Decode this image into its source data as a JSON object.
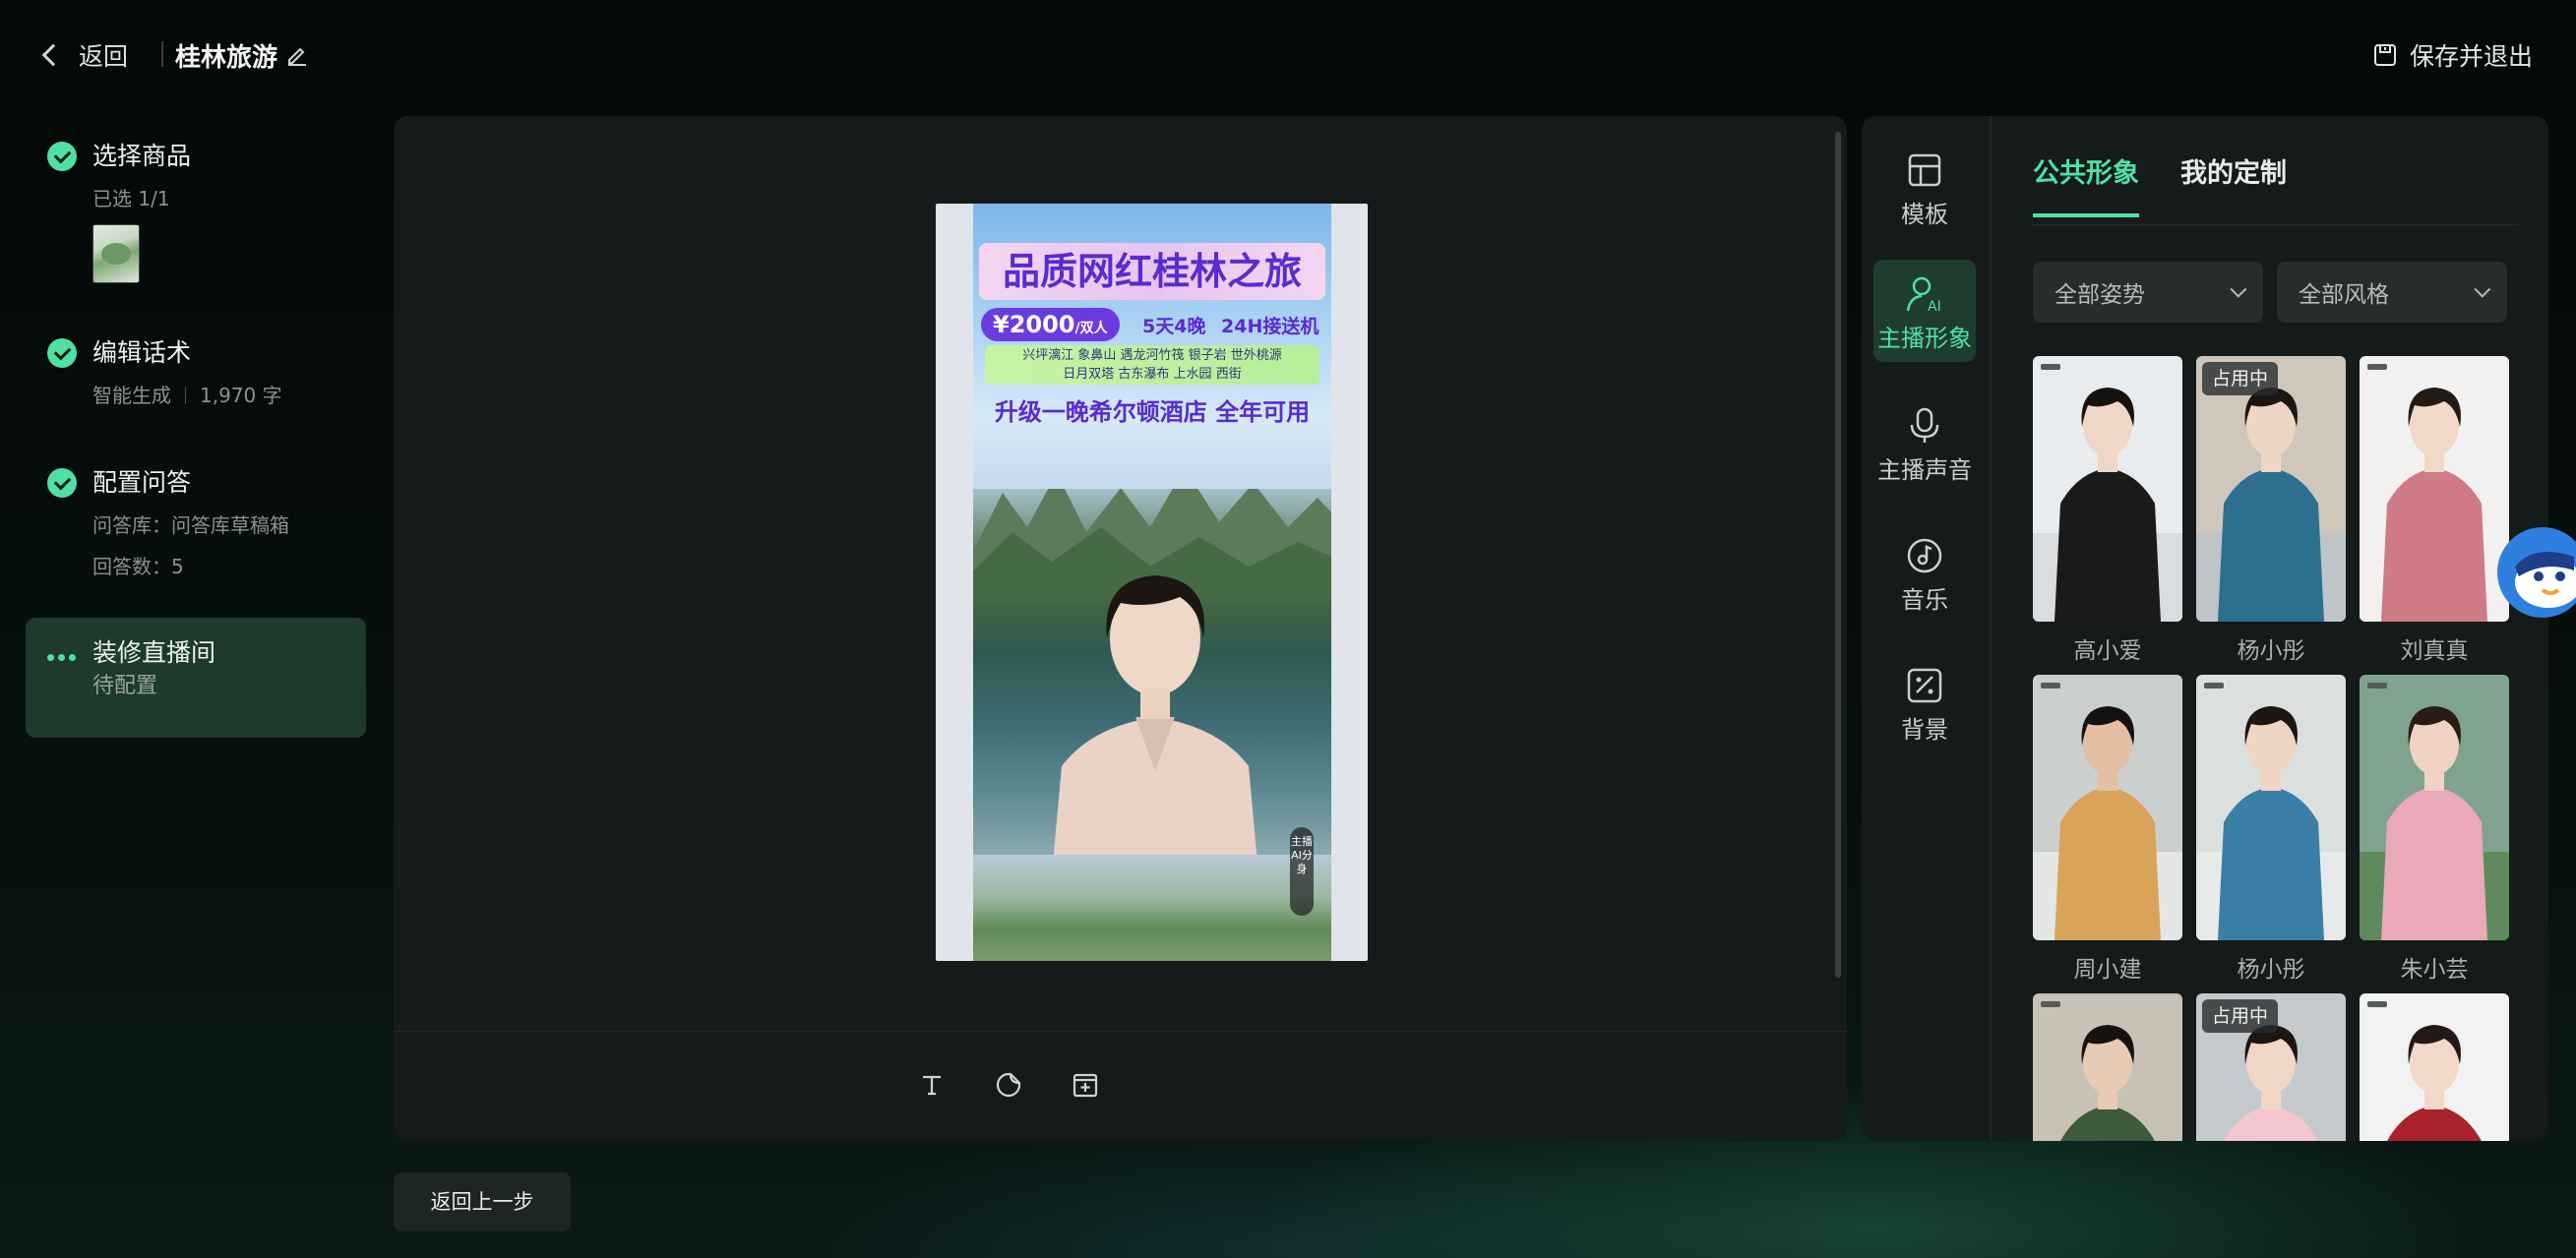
{
  "topbar": {
    "back_label": "返回",
    "project_title": "桂林旅游",
    "save_exit_label": "保存并退出"
  },
  "steps": [
    {
      "title": "选择商品",
      "sub": "已选 1/1",
      "status": "done"
    },
    {
      "title": "编辑话术",
      "sub_a": "智能生成",
      "sub_b": "1,970 字",
      "status": "done"
    },
    {
      "title": "配置问答",
      "sub_a": "问答库：问答库草稿箱",
      "sub_b": "回答数：5",
      "status": "done"
    },
    {
      "title": "装修直播间",
      "sub": "待配置",
      "status": "in-progress"
    }
  ],
  "preview": {
    "headline": "品质网红桂林之旅",
    "price": "¥2000",
    "price_unit": "/双人",
    "tag_days": "5天4晚",
    "tag_pickup": "24H接送机",
    "spots_line1": "兴坪漓江  象鼻山  遇龙河竹筏  银子岩  世外桃源",
    "spots_line2": "日月双塔  古东瀑布  上水园  西街",
    "upgrade": "升级一晚希尔顿酒店  全年可用",
    "ai_badge": "主播AI分身"
  },
  "rail": [
    {
      "label": "模板",
      "icon": "template-icon"
    },
    {
      "label": "主播形象",
      "icon": "avatar-ai-icon",
      "active": true
    },
    {
      "label": "主播声音",
      "icon": "microphone-icon"
    },
    {
      "label": "音乐",
      "icon": "music-icon"
    },
    {
      "label": "背景",
      "icon": "background-icon"
    }
  ],
  "tabs": [
    {
      "label": "公共形象",
      "active": true
    },
    {
      "label": "我的定制",
      "active": false
    }
  ],
  "filters": {
    "pose": "全部姿势",
    "style": "全部风格"
  },
  "inuse_label": "占用中",
  "avatars": [
    {
      "name": "高小爱",
      "in_use": false
    },
    {
      "name": "杨小彤",
      "in_use": true
    },
    {
      "name": "刘真真",
      "in_use": false
    },
    {
      "name": "周小建",
      "in_use": false
    },
    {
      "name": "杨小彤",
      "in_use": false
    },
    {
      "name": "朱小芸",
      "in_use": false
    },
    {
      "name": "",
      "in_use": false
    },
    {
      "name": "",
      "in_use": true
    },
    {
      "name": "",
      "in_use": false
    }
  ],
  "prev_step_label": "返回上一步",
  "colors": {
    "accent": "#4fe0a4",
    "panel": "#151b1a",
    "active_step_bg": "#1d3a2b",
    "poster_purple": "#5a2bd0"
  }
}
